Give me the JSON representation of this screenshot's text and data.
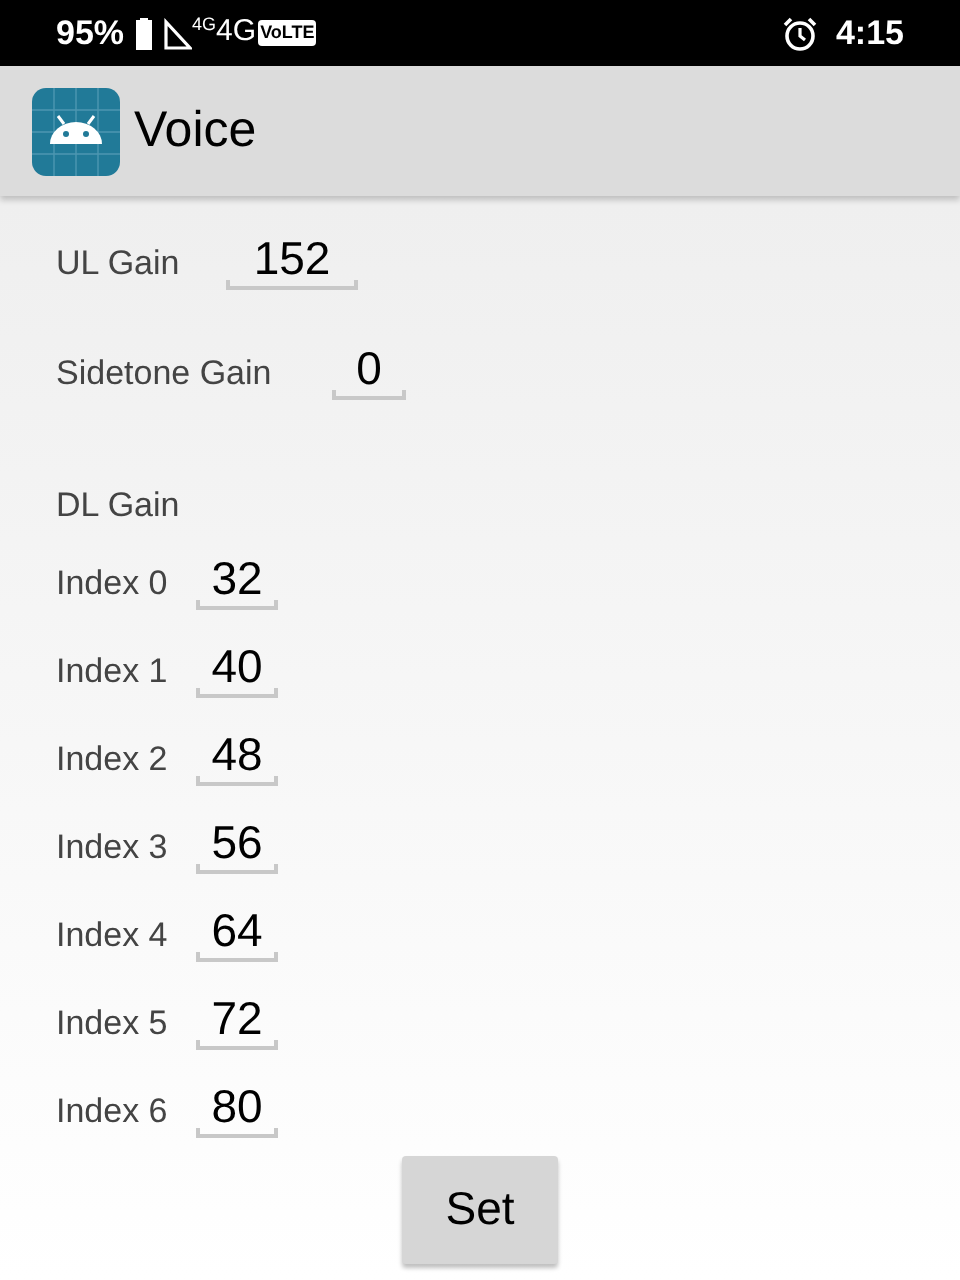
{
  "status_bar": {
    "battery": "95%",
    "network_small": "4G",
    "network": "4G",
    "volte": "VoLTE",
    "time": "4:15"
  },
  "app_bar": {
    "title": "Voice"
  },
  "ul_gain": {
    "label": "UL Gain",
    "value": "152"
  },
  "sidetone_gain": {
    "label": "Sidetone Gain",
    "value": "0"
  },
  "dl_gain": {
    "heading": "DL Gain",
    "rows": [
      {
        "label": "Index 0",
        "value": "32"
      },
      {
        "label": "Index 1",
        "value": "40"
      },
      {
        "label": "Index 2",
        "value": "48"
      },
      {
        "label": "Index 3",
        "value": "56"
      },
      {
        "label": "Index 4",
        "value": "64"
      },
      {
        "label": "Index 5",
        "value": "72"
      },
      {
        "label": "Index 6",
        "value": "80"
      }
    ]
  },
  "buttons": [
    "Set"
  ]
}
